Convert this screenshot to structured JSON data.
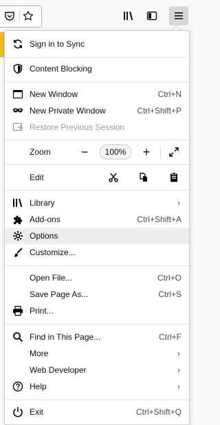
{
  "toolbar": {
    "buttons": [
      {
        "name": "pocket-icon"
      },
      {
        "name": "bookmark-star-icon"
      },
      {
        "name": "library-icon"
      },
      {
        "name": "sidebar-icon"
      },
      {
        "name": "hamburger-menu-icon"
      }
    ]
  },
  "menu": {
    "sync": {
      "label": "Sign in to Sync",
      "icon": "sync-icon"
    },
    "content_blocking": {
      "label": "Content Blocking",
      "icon": "shield-icon"
    },
    "new_window": {
      "label": "New Window",
      "shortcut": "Ctrl+N",
      "icon": "new-window-icon"
    },
    "new_private_window": {
      "label": "New Private Window",
      "shortcut": "Ctrl+Shift+P",
      "icon": "private-mask-icon"
    },
    "restore_session": {
      "label": "Restore Previous Session",
      "icon": "restore-session-icon"
    },
    "zoom": {
      "label": "Zoom",
      "value": "100%",
      "minus": "−",
      "plus": "+"
    },
    "edit": {
      "label": "Edit"
    },
    "library": {
      "label": "Library",
      "icon": "library-icon"
    },
    "addons": {
      "label": "Add-ons",
      "shortcut": "Ctrl+Shift+A",
      "icon": "puzzle-icon"
    },
    "options": {
      "label": "Options",
      "icon": "gear-icon"
    },
    "customize": {
      "label": "Customize...",
      "icon": "brush-icon"
    },
    "open_file": {
      "label": "Open File...",
      "shortcut": "Ctrl+O"
    },
    "save_page": {
      "label": "Save Page As...",
      "shortcut": "Ctrl+S"
    },
    "print": {
      "label": "Print...",
      "icon": "printer-icon"
    },
    "find": {
      "label": "Find in This Page...",
      "shortcut": "Ctrl+F",
      "icon": "search-icon"
    },
    "more": {
      "label": "More"
    },
    "web_developer": {
      "label": "Web Developer"
    },
    "help": {
      "label": "Help",
      "icon": "help-icon"
    },
    "exit": {
      "label": "Exit",
      "shortcut": "Ctrl+Shift+Q",
      "icon": "power-icon"
    },
    "submenu_arrow": "›"
  },
  "colors": {
    "accent_strip": "#ffbf00",
    "hover_row": "#ededf0",
    "disabled_text": "#9a9a9d"
  }
}
